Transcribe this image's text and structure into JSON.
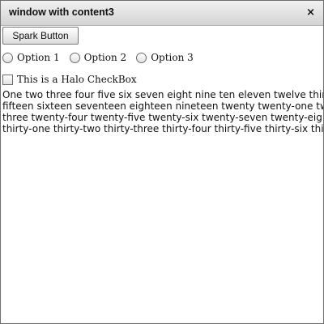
{
  "window": {
    "title": "window with content3",
    "close_glyph": "×"
  },
  "controls": {
    "spark_button_label": "Spark Button",
    "radio_options": [
      "Option 1",
      "Option 2",
      "Option 3"
    ],
    "checkbox_label": "This is a Halo CheckBox"
  },
  "text_block": {
    "content": "One two three four five six seven eight nine ten eleven twelve thirteen fourteen fifteen sixteen seventeen eighteen nineteen twenty twenty-one twenty-two twenty-three twenty-four twenty-five twenty-six twenty-seven twenty-eight twenty-nine thirty thirty-one thirty-two thirty-three thirty-four thirty-five thirty-six thirty-seven."
  },
  "icons": {
    "close": "close-icon",
    "radio": "radio-circle-icon",
    "checkbox": "checkbox-icon"
  }
}
